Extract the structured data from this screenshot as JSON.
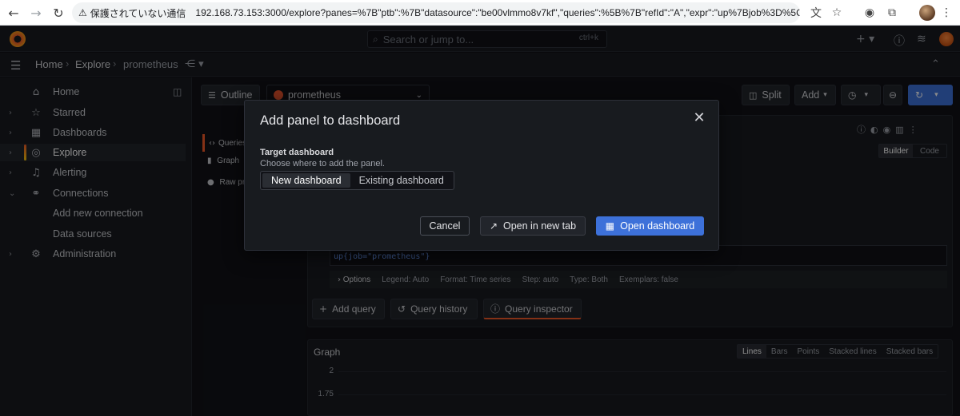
{
  "browser": {
    "warning_text": "保護されていない通信",
    "url": "192.168.73.153:3000/explore?panes=%7B\"ptb\":%7B\"datasource\":\"be00vlmmo8v7kf\",\"queries\":%5B%7B\"refId\":\"A\",\"expr\":\"up%7Bjob%3D%5C\"prometheus%5C\"..."
  },
  "topbar": {
    "search_placeholder": "Search or jump to...",
    "search_shortcut": "ctrl+k"
  },
  "breadcrumb": {
    "items": [
      "Home",
      "Explore",
      "prometheus"
    ]
  },
  "sidebar": {
    "items": [
      {
        "label": "Home",
        "icon": "home-icon"
      },
      {
        "label": "Starred",
        "icon": "star-icon"
      },
      {
        "label": "Dashboards",
        "icon": "grid-icon"
      },
      {
        "label": "Explore",
        "icon": "compass-icon"
      },
      {
        "label": "Alerting",
        "icon": "bell-icon"
      },
      {
        "label": "Connections",
        "icon": "plug-icon"
      },
      {
        "label": "Add new connection",
        "icon": ""
      },
      {
        "label": "Data sources",
        "icon": ""
      },
      {
        "label": "Administration",
        "icon": "gear-icon"
      }
    ]
  },
  "explore": {
    "outline_label": "Outline",
    "datasource": "prometheus",
    "split_label": "Split",
    "add_label": "Add",
    "outline_items": [
      "Queries",
      "Graph",
      "Raw prometheus"
    ],
    "query_tabs": {
      "builder": "Builder",
      "code": "Code"
    },
    "query_expr": "up{job=\"prometheus\"}",
    "options": {
      "label": "Options",
      "legend": "Legend: Auto",
      "format": "Format: Time series",
      "step": "Step: auto",
      "type": "Type: Both",
      "exemplars": "Exemplars: false"
    },
    "actions": {
      "add_query": "Add query",
      "query_history": "Query history",
      "query_inspector": "Query inspector"
    },
    "graph": {
      "title": "Graph",
      "modes": [
        "Lines",
        "Bars",
        "Points",
        "Stacked lines",
        "Stacked bars"
      ],
      "y_ticks": [
        "2",
        "1.75"
      ]
    }
  },
  "modal": {
    "title": "Add panel to dashboard",
    "target_label": "Target dashboard",
    "target_description": "Choose where to add the panel.",
    "options": [
      "New dashboard",
      "Existing dashboard"
    ],
    "cancel": "Cancel",
    "open_new_tab": "Open in new tab",
    "open_dashboard": "Open dashboard"
  },
  "colors": {
    "primary": "#3d71d9",
    "background": "#111217",
    "panel": "#181b1f"
  }
}
